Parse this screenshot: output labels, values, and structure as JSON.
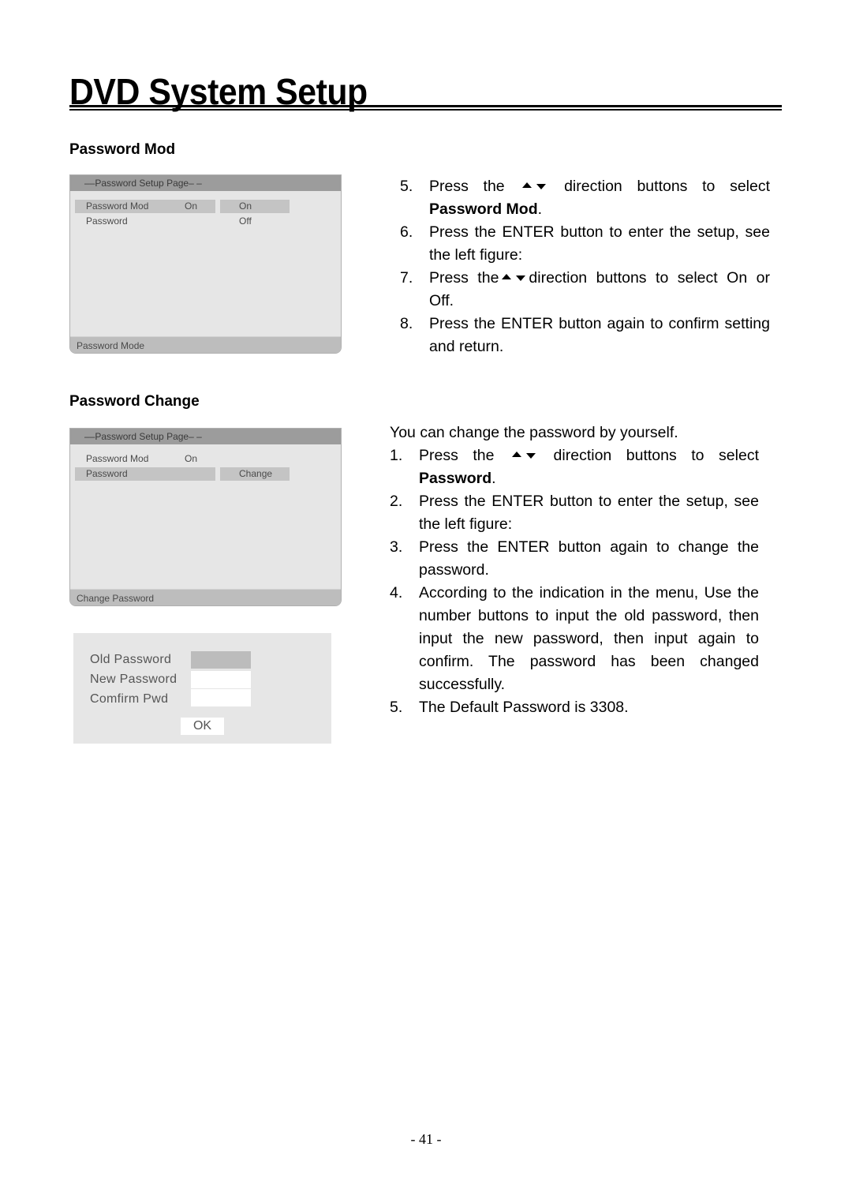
{
  "page": {
    "title": "DVD System Setup",
    "page_number": "- 41 -"
  },
  "sections": {
    "password_mod": {
      "heading": "Password Mod",
      "screen": {
        "header": "––Password Setup Page– –",
        "rows": [
          {
            "label": "Password Mod",
            "value": "On",
            "option": "On",
            "highlighted": true
          },
          {
            "label": "Password",
            "value": "",
            "option": "Off",
            "highlighted": false
          }
        ],
        "footer": "Password Mode"
      },
      "steps": [
        {
          "num": "5.",
          "pre": "Press the",
          "post": "direction buttons to select",
          "bold": "Password Mod",
          "tail": "."
        },
        {
          "num": "6.",
          "text": "Press the ENTER button to enter the setup, see the left figure:"
        },
        {
          "num": "7.",
          "pre": "Press the",
          "post": "direction buttons to select On or Off."
        },
        {
          "num": "8.",
          "text": "Press the ENTER button again to confirm setting and return."
        }
      ]
    },
    "password_change": {
      "heading": "Password Change",
      "screen": {
        "header": "––Password Setup Page– –",
        "rows": [
          {
            "label": "Password Mod",
            "value": "On",
            "option": "",
            "highlighted": false
          },
          {
            "label": "Password",
            "value": "",
            "option": "Change",
            "highlighted": true
          }
        ],
        "footer": "Change Password"
      },
      "dialog": {
        "fields": [
          {
            "label": "Old Password",
            "value": "",
            "active": true
          },
          {
            "label": "New Password",
            "value": "",
            "active": false
          },
          {
            "label": "Comfirm Pwd",
            "value": "",
            "active": false
          }
        ],
        "ok_label": "OK"
      },
      "intro": "You can change the password by yourself.",
      "steps": [
        {
          "num": "1.",
          "pre": "Press the",
          "post": "direction buttons to select",
          "bold": "Password",
          "tail": "."
        },
        {
          "num": "2.",
          "text": "Press the ENTER button to enter the setup, see the left figure:"
        },
        {
          "num": "3.",
          "text": "Press the ENTER button again to change the password."
        },
        {
          "num": "4.",
          "text": "According to the indication in the menu, Use the number buttons to input the old password, then input the new password, then input again to confirm. The password has been changed successfully."
        },
        {
          "num": "5.",
          "text": "The Default Password is 3308."
        }
      ]
    }
  },
  "icons": {
    "up": "up-triangle-icon",
    "down": "down-triangle-icon"
  },
  "colors": {
    "osd_background": "#e6e6e6",
    "osd_header": "#9c9c9c",
    "osd_highlight": "#c4c4c4",
    "osd_footer": "#bdbdbd"
  }
}
